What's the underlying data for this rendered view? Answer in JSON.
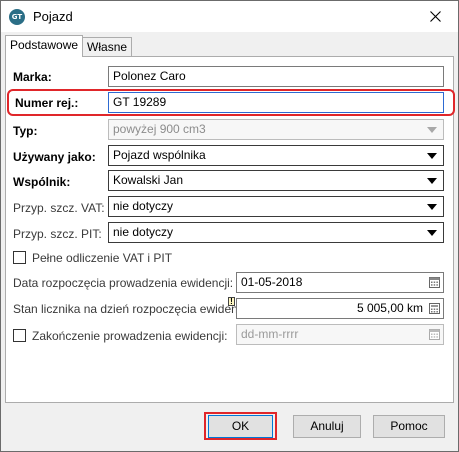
{
  "window": {
    "title": "Pojazd",
    "app_icon_text": "GT"
  },
  "tabs": [
    {
      "label": "Podstawowe",
      "active": true
    },
    {
      "label": "Własne",
      "active": false
    }
  ],
  "form": {
    "marka": {
      "label": "Marka:",
      "value": "Polonez Caro"
    },
    "numer_rej": {
      "label": "Numer rej.:",
      "value": "GT 19289"
    },
    "typ": {
      "label": "Typ:",
      "value": "powyżej 900 cm3"
    },
    "uzywany_jako": {
      "label": "Używany jako:",
      "value": "Pojazd wspólnika"
    },
    "wspolnik": {
      "label": "Wspólnik:",
      "value": "Kowalski Jan"
    },
    "przyp_vat": {
      "label": "Przyp. szcz. VAT:",
      "value": "nie dotyczy"
    },
    "przyp_pit": {
      "label": "Przyp. szcz. PIT:",
      "value": "nie dotyczy"
    },
    "pelne_odliczenie": {
      "label": "Pełne odliczenie VAT i PIT",
      "checked": false
    },
    "data_rozpoczecia": {
      "label": "Data rozpoczęcia prowadzenia ewidencji:",
      "value": "01-05-2018"
    },
    "stan_licznika": {
      "label": "Stan licznika na dzień rozpoczęcia ewidencji:",
      "value": "5 005,00 km"
    },
    "zakonczenie": {
      "label": "Zakończenie prowadzenia ewidencji:",
      "placeholder": "dd-mm-rrrr",
      "checked": false
    }
  },
  "buttons": {
    "ok": "OK",
    "cancel": "Anuluj",
    "help": "Pomoc"
  },
  "colors": {
    "highlight": "#e0262a",
    "focus_border": "#0078d7"
  }
}
